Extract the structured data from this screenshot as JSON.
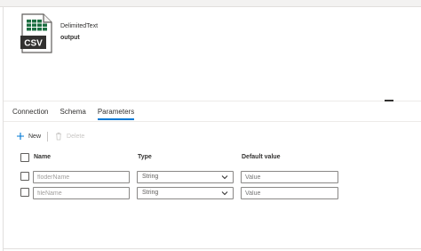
{
  "dataset": {
    "icon_label": "CSV",
    "type": "DelimitedText",
    "name": "output"
  },
  "tabs": [
    {
      "label": "Connection",
      "active": false
    },
    {
      "label": "Schema",
      "active": false
    },
    {
      "label": "Parameters",
      "active": true
    }
  ],
  "toolbar": {
    "new_label": "New",
    "delete_label": "Delete"
  },
  "table": {
    "columns": {
      "name": "Name",
      "type": "Type",
      "default": "Default value"
    },
    "rows": [
      {
        "name": "floderName",
        "type": "String",
        "default_placeholder": "Value"
      },
      {
        "name": "fileName",
        "type": "String",
        "default_placeholder": "Value"
      }
    ]
  },
  "colors": {
    "accent": "#0078d4",
    "excel_green": "#1d6f42"
  }
}
